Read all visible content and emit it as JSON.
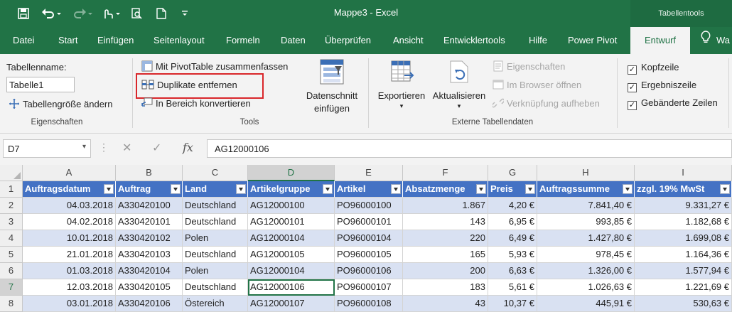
{
  "window": {
    "title": "Mappe3 - Excel",
    "context_tab_title": "Tabellentools"
  },
  "qat": {
    "save_icon": "save-icon",
    "undo_icon": "undo-icon",
    "redo_icon": "redo-icon",
    "touch_icon": "touch-icon",
    "preview_icon": "print-preview-icon",
    "new_icon": "new-file-icon",
    "customize_icon": "customize-icon"
  },
  "menu": {
    "items": [
      "Datei",
      "Start",
      "Einfügen",
      "Seitenlayout",
      "Formeln",
      "Daten",
      "Überprüfen",
      "Ansicht",
      "Entwicklertools",
      "Hilfe",
      "Power Pivot"
    ],
    "active": "Entwurf",
    "tell": "Wa"
  },
  "ribbon": {
    "eigenschaften": {
      "tabellenname_label": "Tabellenname:",
      "tabellenname_value": "Tabelle1",
      "resize": "Tabellengröße ändern",
      "group": "Eigenschaften"
    },
    "tools": {
      "pivot": "Mit PivotTable zusammenfassen",
      "duplicates": "Duplikate entfernen",
      "convert": "In Bereich konvertieren",
      "slicer_line1": "Datenschnitt",
      "slicer_line2": "einfügen",
      "group": "Tools"
    },
    "extern": {
      "export": "Exportieren",
      "refresh": "Aktualisieren",
      "properties": "Eigenschaften",
      "browser": "Im Browser öffnen",
      "unlink": "Verknüpfung aufheben",
      "group": "Externe Tabellendaten"
    },
    "options": {
      "header_row": "Kopfzeile",
      "total_row": "Ergebniszeile",
      "banded_rows": "Gebänderte Zeilen"
    }
  },
  "formula_bar": {
    "cell_ref": "D7",
    "value": "AG12000106"
  },
  "sheet": {
    "columns": [
      "A",
      "B",
      "C",
      "D",
      "E",
      "F",
      "G",
      "H",
      "I"
    ],
    "row_numbers": [
      "1",
      "2",
      "3",
      "4",
      "5",
      "6",
      "7",
      "8"
    ],
    "headers": [
      "Auftragsdatum",
      "Auftrag",
      "Land",
      "Artikelgruppe",
      "Artikel",
      "Absatzmenge",
      "Preis",
      "Auftragssumme",
      "zzgl. 19% MwSt"
    ],
    "rows": [
      [
        "04.03.2018",
        "A330420100",
        "Deutschland",
        "AG12000100",
        "PO96000100",
        "1.867",
        "4,20 €",
        "7.841,40 €",
        "9.331,27 €"
      ],
      [
        "04.02.2018",
        "A330420101",
        "Deutschland",
        "AG12000101",
        "PO96000101",
        "143",
        "6,95 €",
        "993,85 €",
        "1.182,68 €"
      ],
      [
        "10.01.2018",
        "A330420102",
        "Polen",
        "AG12000104",
        "PO96000104",
        "220",
        "6,49 €",
        "1.427,80 €",
        "1.699,08 €"
      ],
      [
        "21.01.2018",
        "A330420103",
        "Deutschland",
        "AG12000105",
        "PO96000105",
        "165",
        "5,93 €",
        "978,45 €",
        "1.164,36 €"
      ],
      [
        "01.03.2018",
        "A330420104",
        "Polen",
        "AG12000104",
        "PO96000106",
        "200",
        "6,63 €",
        "1.326,00 €",
        "1.577,94 €"
      ],
      [
        "12.03.2018",
        "A330420105",
        "Deutschland",
        "AG12000106",
        "PO96000107",
        "183",
        "5,61 €",
        "1.026,63 €",
        "1.221,69 €"
      ],
      [
        "03.01.2018",
        "A330420106",
        "Östereich",
        "AG12000107",
        "PO96000108",
        "43",
        "10,37 €",
        "445,91 €",
        "530,63 €"
      ]
    ]
  }
}
